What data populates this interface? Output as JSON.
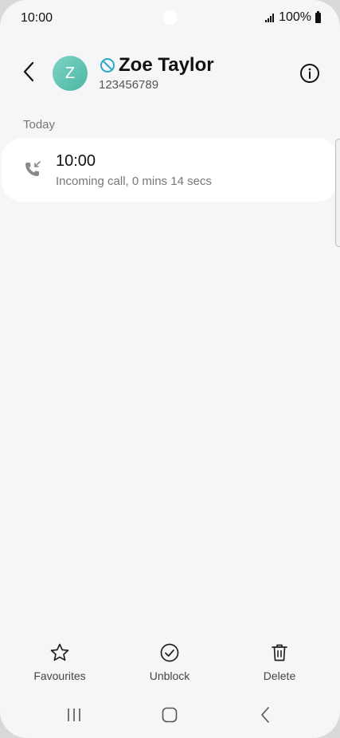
{
  "status_bar": {
    "time": "10:00",
    "battery": "100%"
  },
  "header": {
    "avatar_initial": "Z",
    "contact_name": "Zoe Taylor",
    "phone_number": "123456789",
    "blocked": true,
    "avatar_color": "#5cc1ad",
    "blocked_icon_color": "#2aa9c7"
  },
  "call_log": {
    "section_label": "Today",
    "entries": [
      {
        "time": "10:00",
        "description": "Incoming call, 0 mins 14 secs",
        "icon": "incoming-call-icon"
      }
    ]
  },
  "actions": {
    "favourites_label": "Favourites",
    "unblock_label": "Unblock",
    "delete_label": "Delete"
  },
  "nav": {
    "recents": "recents-icon",
    "home": "home-icon",
    "back": "back-icon"
  }
}
